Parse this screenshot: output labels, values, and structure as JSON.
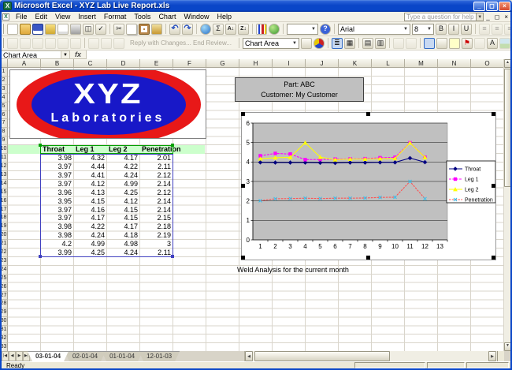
{
  "window": {
    "title": "Microsoft Excel - XYZ Lab Live Report.xls",
    "controls": [
      "minimize",
      "restore",
      "close"
    ]
  },
  "menu": {
    "items": [
      "File",
      "Edit",
      "View",
      "Insert",
      "Format",
      "Tools",
      "Chart",
      "Window",
      "Help"
    ],
    "question_box_placeholder": "Type a question for help"
  },
  "toolbars": {
    "standard": {
      "icons": [
        "new",
        "open",
        "save",
        "permission",
        "mail",
        "print",
        "print-preview",
        "spelling",
        "|",
        "cut",
        "copy",
        "paste",
        "format-painter",
        "|",
        "undo",
        "redo",
        "|",
        "hyperlink",
        "autosum",
        "sort-asc",
        "sort-desc",
        "|",
        "chart-wizard",
        "drawing",
        "|"
      ],
      "zoom_value": "",
      "font_name": "Arial",
      "font_size": "8",
      "icons2": [
        "bold",
        "italic",
        "underline",
        "|",
        "~align-left",
        "~align-center",
        "~align-right",
        "|",
        "borders",
        "overflow"
      ]
    },
    "reviewing_chart": {
      "icons_left": [
        "~edit-comment",
        "~previous-comment",
        "~next-comment",
        "~delete-comment",
        "~create-outlook-task",
        "~show-ink",
        "|",
        "~update-file",
        "~send-mail",
        "~open-original"
      ],
      "review_label": "Reply with Changes... End Review...",
      "chart_object_selector": "Chart Area",
      "icons_right": [
        "format-chart-area",
        "chart-type",
        "|",
        "legend*",
        "data-table",
        "|",
        "by-row",
        "by-column",
        "|",
        "~angle-counterclockwise",
        "~angle-clockwise",
        "|",
        "chart*",
        "format-picture",
        "comment",
        "flag",
        "~checkbox",
        "text-a",
        "~image",
        "overflow"
      ]
    }
  },
  "icon_glyphs": {
    "undo": "↶",
    "redo": "↷",
    "autosum": "Σ",
    "help": "?",
    "cut": "✂",
    "bold": "B",
    "italic": "I",
    "underline": "U",
    "align-left": "≡",
    "align-center": "≡",
    "align-right": "≡",
    "sort-asc": "A↓",
    "sort-desc": "Z↓",
    "text-a": "A",
    "flag": "⚑",
    "legend": "≣",
    "data-table": "▦",
    "by-row": "▤",
    "by-column": "▥",
    "overflow": "»",
    "spelling": "✓",
    "print-preview": "◫",
    "borders": "⊞",
    "minimize": "_",
    "restore": "◻",
    "close": "×",
    "tab-first": "|◀",
    "tab-prev": "◀",
    "tab-next": "▶",
    "tab-last": "▶|",
    "scroll-up": "▲",
    "scroll-down": "▼",
    "scroll-left": "◀",
    "scroll-right": "▶",
    "excel-logo": "X",
    "workbook": "X",
    "dropdown": "▼"
  },
  "formula_bar": {
    "name_box": "Chart Area",
    "fx_label": "fx",
    "formula_value": ""
  },
  "sheet": {
    "columns": [
      "A",
      "B",
      "C",
      "D",
      "E",
      "F",
      "G",
      "H",
      "I",
      "J",
      "K",
      "L",
      "M",
      "N",
      "O"
    ],
    "row_count": 33,
    "logo": {
      "line1": "XYZ",
      "line2": "Laboratories"
    },
    "part_box": {
      "line1": "Part: ABC",
      "line2": "Customer: My Customer"
    },
    "table": {
      "headers": [
        "Throat",
        "Leg 1",
        "Leg 2",
        "Penetration"
      ],
      "rows": [
        [
          "3.98",
          "4.32",
          "4.17",
          "2.01"
        ],
        [
          "3.97",
          "4.44",
          "4.22",
          "2.11"
        ],
        [
          "3.97",
          "4.41",
          "4.24",
          "2.12"
        ],
        [
          "3.97",
          "4.12",
          "4.99",
          "2.14"
        ],
        [
          "3.96",
          "4.13",
          "4.25",
          "2.12"
        ],
        [
          "3.95",
          "4.15",
          "4.12",
          "2.14"
        ],
        [
          "3.97",
          "4.16",
          "4.15",
          "2.14"
        ],
        [
          "3.97",
          "4.17",
          "4.15",
          "2.15"
        ],
        [
          "3.98",
          "4.22",
          "4.17",
          "2.18"
        ],
        [
          "3.98",
          "4.24",
          "4.18",
          "2.19"
        ],
        [
          "4.2",
          "4.99",
          "4.98",
          "3"
        ],
        [
          "3.99",
          "4.25",
          "4.24",
          "2.11"
        ]
      ]
    },
    "note": "Weld Analysis for the current month"
  },
  "chart_data": {
    "type": "line",
    "title": "",
    "x": [
      1,
      2,
      3,
      4,
      5,
      6,
      7,
      8,
      9,
      10,
      11,
      12
    ],
    "x_axis_ticks": [
      1,
      2,
      3,
      4,
      5,
      6,
      7,
      8,
      9,
      10,
      11,
      12,
      13
    ],
    "ylim": [
      0,
      6
    ],
    "yticks": [
      0,
      1,
      2,
      3,
      4,
      5,
      6
    ],
    "grid": true,
    "legend_position": "right",
    "plot_bg": "#C0C0C0",
    "series": [
      {
        "name": "Throat",
        "color": "#000080",
        "marker": "diamond",
        "dash": "",
        "values": [
          3.98,
          3.97,
          3.97,
          3.97,
          3.96,
          3.95,
          3.97,
          3.97,
          3.98,
          3.98,
          4.2,
          3.99
        ]
      },
      {
        "name": "Leg 1",
        "color": "#FF00FF",
        "marker": "square",
        "dash": "3 1.3",
        "values": [
          4.32,
          4.44,
          4.41,
          4.12,
          4.13,
          4.15,
          4.16,
          4.17,
          4.22,
          4.24,
          4.99,
          4.25
        ]
      },
      {
        "name": "Leg 2",
        "color": "#FFFF00",
        "marker": "triangle",
        "dash": "",
        "values": [
          4.17,
          4.22,
          4.24,
          4.99,
          4.25,
          4.12,
          4.15,
          4.15,
          4.17,
          4.18,
          4.98,
          4.24
        ]
      },
      {
        "name": "Penetration",
        "color": "#FF5050",
        "marker": "x",
        "marker_color": "#30C0F0",
        "dash": "2.5 1.3",
        "values": [
          2.01,
          2.11,
          2.12,
          2.14,
          2.12,
          2.14,
          2.14,
          2.15,
          2.18,
          2.19,
          3,
          2.11
        ]
      }
    ]
  },
  "tabs": {
    "nav": [
      "tab-first",
      "tab-prev",
      "tab-next",
      "tab-last"
    ],
    "sheets": [
      "03-01-04",
      "02-01-04",
      "01-01-04",
      "12-01-03"
    ],
    "active": "03-01-04"
  },
  "status": {
    "left": "Ready"
  }
}
